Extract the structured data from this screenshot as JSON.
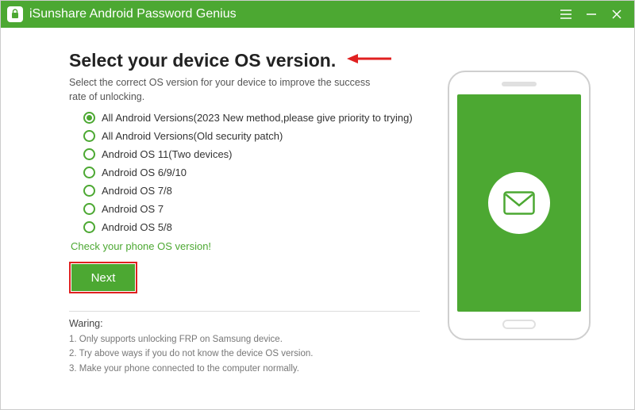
{
  "titlebar": {
    "app_name": "iSunshare Android Password Genius"
  },
  "main": {
    "heading": "Select your device OS version.",
    "subheading": "Select the correct OS version for your device to improve the success rate of unlocking.",
    "options": [
      "All Android Versions(2023 New method,please give priority to trying)",
      "All Android Versions(Old security patch)",
      "Android OS 11(Two devices)",
      "Android OS 6/9/10",
      "Android OS 7/8",
      "Android OS 7",
      "Android OS 5/8"
    ],
    "selected_index": 0,
    "check_link": "Check your phone OS version!",
    "next_label": "Next"
  },
  "warning": {
    "title": "Waring:",
    "items": [
      "1. Only supports unlocking FRP on Samsung device.",
      "2. Try above ways if you do not know the device OS version.",
      "3. Make your phone connected to the computer normally."
    ]
  }
}
